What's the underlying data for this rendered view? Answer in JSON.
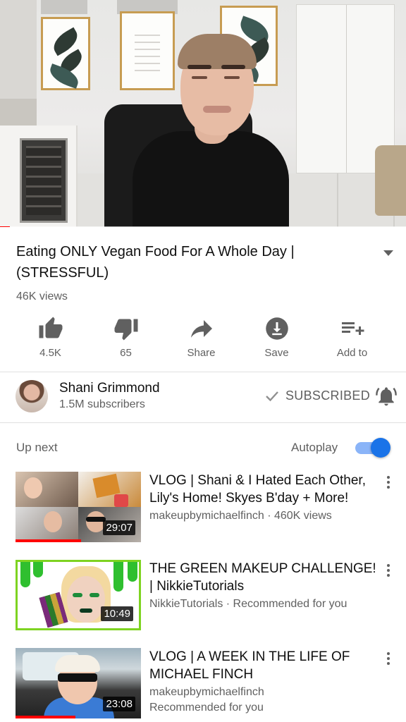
{
  "video": {
    "title": "Eating ONLY Vegan Food For A Whole Day | (STRESSFUL)",
    "views": "46K views",
    "progress_fraction": 0.025
  },
  "actions": [
    {
      "icon": "thumb-up-icon",
      "label": "4.5K"
    },
    {
      "icon": "thumb-down-icon",
      "label": "65"
    },
    {
      "icon": "share-icon",
      "label": "Share"
    },
    {
      "icon": "download-icon",
      "label": "Save"
    },
    {
      "icon": "add-to-playlist-icon",
      "label": "Add to"
    }
  ],
  "channel": {
    "name": "Shani Grimmond",
    "subscribers": "1.5M subscribers",
    "subscribe_label": "SUBSCRIBED"
  },
  "up_next": {
    "label": "Up next",
    "autoplay_label": "Autoplay",
    "autoplay_on": true
  },
  "videos": [
    {
      "title": "VLOG | Shani & I Hated Each Other, Lily's Home! Skyes B'day + More!",
      "meta1": "makeupbymichaelfinch · 460K views",
      "meta2": "",
      "duration": "29:07",
      "watched_fraction": 0.52
    },
    {
      "title": "THE GREEN MAKEUP CHALLENGE! | NikkieTutorials",
      "meta1": "NikkieTutorials · Recommended for you",
      "meta2": "",
      "duration": "10:49",
      "watched_fraction": 0
    },
    {
      "title": "VLOG | A WEEK IN THE LIFE OF MICHAEL FINCH",
      "meta1": "makeupbymichaelfinch",
      "meta2": "Recommended for you",
      "duration": "23:08",
      "watched_fraction": 0.48
    }
  ],
  "colors": {
    "progress_red": "#ff0000",
    "toggle_blue": "#1a73e8",
    "secondary_text": "#606060"
  }
}
